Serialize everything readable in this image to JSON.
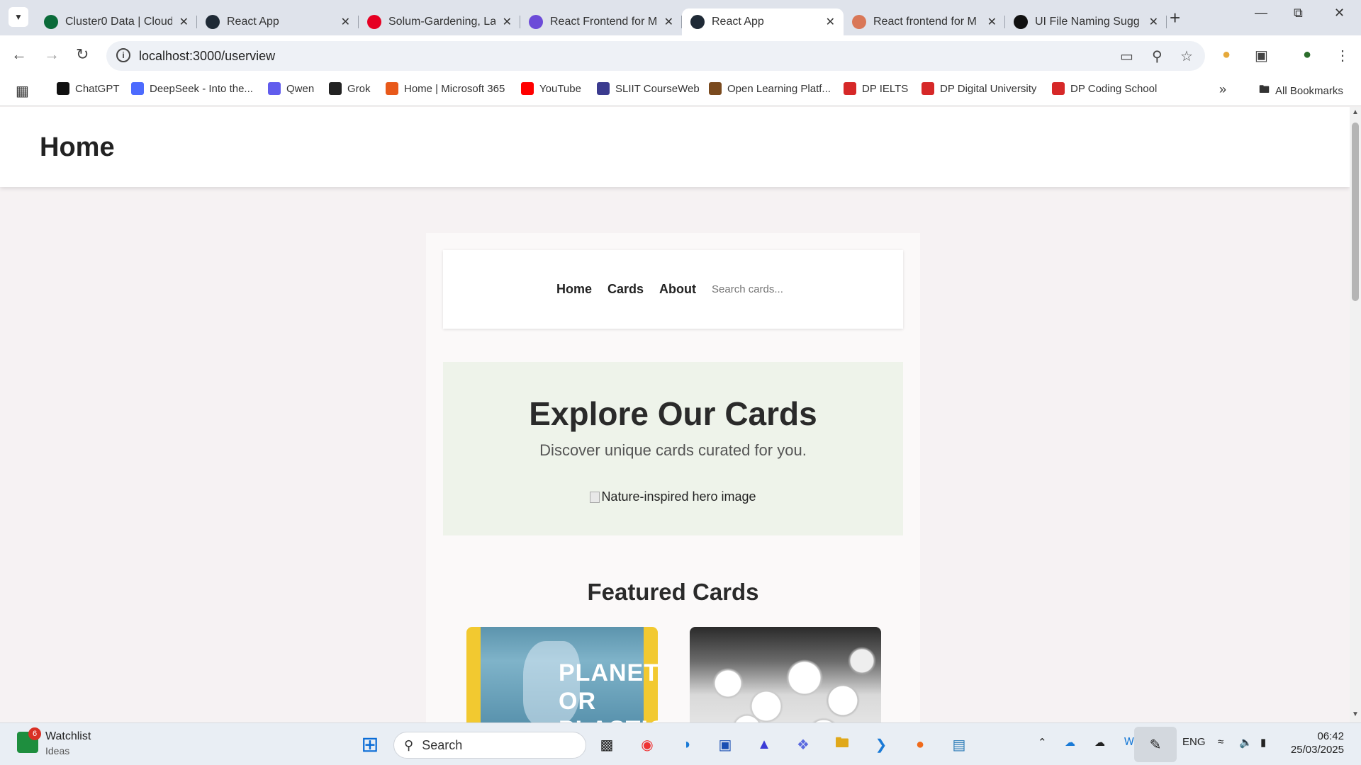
{
  "browser": {
    "tabs": [
      {
        "title": "Cluster0 Data | Cloud",
        "favicon_color": "#0b6b3a",
        "favicon_icon": "mongodb-leaf-icon"
      },
      {
        "title": "React App",
        "favicon_color": "#1f2a36",
        "favicon_icon": "react-icon"
      },
      {
        "title": "Solum-Gardening, La",
        "favicon_color": "#e60023",
        "favicon_icon": "pinterest-icon"
      },
      {
        "title": "React Frontend for M",
        "favicon_color": "#6c4bd8",
        "favicon_icon": "deepseek-icon"
      },
      {
        "title": "React App",
        "favicon_color": "#1f2a36",
        "favicon_icon": "react-icon",
        "active": true
      },
      {
        "title": "React frontend for M",
        "favicon_color": "#d97757",
        "favicon_icon": "claude-icon"
      },
      {
        "title": "UI File Naming Sugg",
        "favicon_color": "#111111",
        "favicon_icon": "chatgpt-icon"
      }
    ],
    "url": "localhost:3000/userview",
    "bookmarks": [
      {
        "label": "ChatGPT",
        "color": "#111111"
      },
      {
        "label": "DeepSeek - Into the...",
        "color": "#4d6bfe"
      },
      {
        "label": "Qwen",
        "color": "#615ced"
      },
      {
        "label": "Grok",
        "color": "#222222"
      },
      {
        "label": "Home | Microsoft 365",
        "color": "#e8591a"
      },
      {
        "label": "YouTube",
        "color": "#ff0000"
      },
      {
        "label": "SLIIT CourseWeb",
        "color": "#3b3b8f"
      },
      {
        "label": "Open Learning Platf...",
        "color": "#7a4a1e"
      },
      {
        "label": "DP IELTS",
        "color": "#d62828"
      },
      {
        "label": "DP Digital University",
        "color": "#d62828"
      },
      {
        "label": "DP Coding School",
        "color": "#d62828"
      }
    ],
    "all_bookmarks_label": "All Bookmarks"
  },
  "app": {
    "header_title": "Home",
    "nav": {
      "home": "Home",
      "cards": "Cards",
      "about": "About",
      "search_placeholder": "Search cards..."
    },
    "hero": {
      "title": "Explore Our Cards",
      "subtitle": "Discover unique cards curated for you.",
      "image_alt": "Nature-inspired hero image"
    },
    "featured_title": "Featured Cards",
    "cards": [
      {
        "image_text": "PLANET OR PLASTIC?"
      },
      {
        "image_text": ""
      }
    ]
  },
  "taskbar": {
    "watchlist_title": "Watchlist",
    "watchlist_sub": "Ideas",
    "watchlist_badge": "6",
    "search_label": "Search",
    "language": "ENG",
    "time": "06:42",
    "date": "25/03/2025"
  }
}
